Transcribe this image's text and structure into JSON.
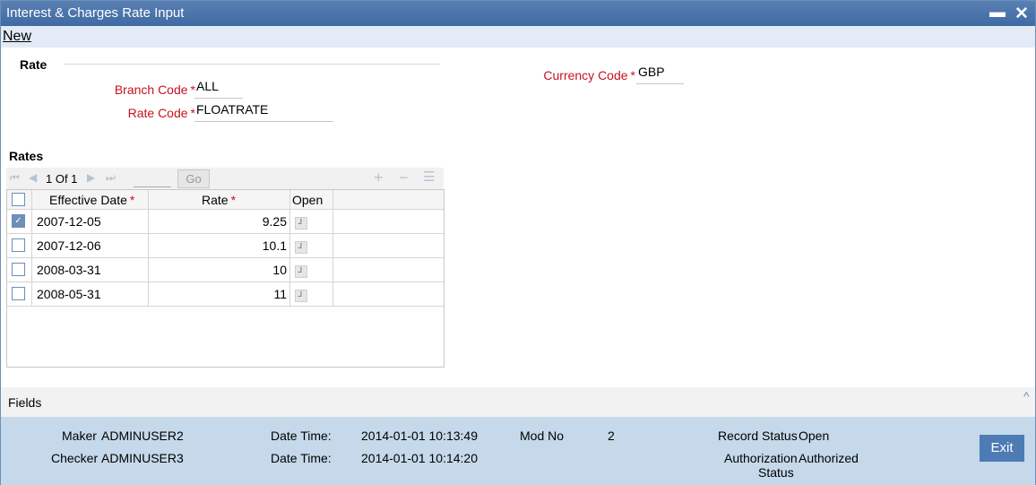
{
  "window": {
    "title": "Interest & Charges Rate Input",
    "minimize": "▬",
    "close": "✕"
  },
  "menu": {
    "new_label": "New"
  },
  "rate_section": {
    "title": "Rate",
    "branch_code_label": "Branch Code",
    "branch_code": "ALL",
    "rate_code_label": "Rate Code",
    "rate_code": "FLOATRATE",
    "currency_code_label": "Currency Code",
    "currency_code": "GBP",
    "required_mark": "*"
  },
  "rates_section": {
    "title": "Rates",
    "pager": {
      "first": "⏮",
      "prev": "◀",
      "page_text": "1 Of 1",
      "next": "▶",
      "last": "⏭",
      "go_label": "Go",
      "add": "+",
      "remove": "−",
      "list": "☰"
    },
    "columns": [
      "Effective Date",
      "Rate",
      "Open"
    ],
    "rows": [
      {
        "date": "2007-12-05",
        "rate": "9.25",
        "checked": true
      },
      {
        "date": "2007-12-06",
        "rate": "10.1",
        "checked": false
      },
      {
        "date": "2008-03-31",
        "rate": "10",
        "checked": false
      },
      {
        "date": "2008-05-31",
        "rate": "11",
        "checked": false
      }
    ]
  },
  "fields": {
    "label": "Fields",
    "caret": "^"
  },
  "audit": {
    "maker_label": "Maker",
    "maker": "ADMINUSER2",
    "checker_label": "Checker",
    "checker": "ADMINUSER3",
    "datetime_label": "Date Time:",
    "maker_datetime": "2014-01-01 10:13:49",
    "checker_datetime": "2014-01-01 10:14:20",
    "mod_no_label": "Mod No",
    "mod_no": "2",
    "record_status_label": "Record Status",
    "record_status": "Open",
    "auth_status_label_1": "Authorization",
    "auth_status_label_2": "Status",
    "auth_status": "Authorized",
    "exit_label": "Exit"
  },
  "colors": {
    "titlebar": "#4a74ab",
    "label_red": "#c8101e",
    "footer": "#c5d9ea",
    "exit_button": "#4d7bb3"
  }
}
